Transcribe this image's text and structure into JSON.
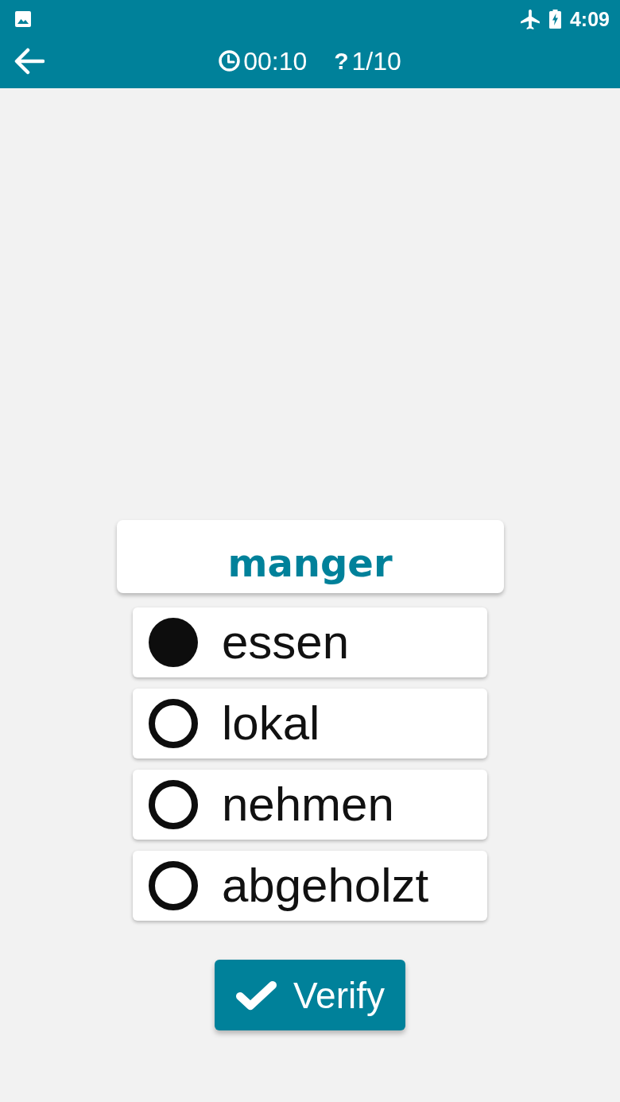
{
  "status_bar": {
    "time": "4:09"
  },
  "toolbar": {
    "timer": "00:10",
    "question_icon": "?",
    "question_counter": "1/10"
  },
  "word": "manger",
  "options": [
    {
      "label": "essen",
      "selected": true
    },
    {
      "label": "lokal",
      "selected": false
    },
    {
      "label": "nehmen",
      "selected": false
    },
    {
      "label": "abgeholzt",
      "selected": false
    }
  ],
  "verify_button": {
    "label": "Verify"
  }
}
